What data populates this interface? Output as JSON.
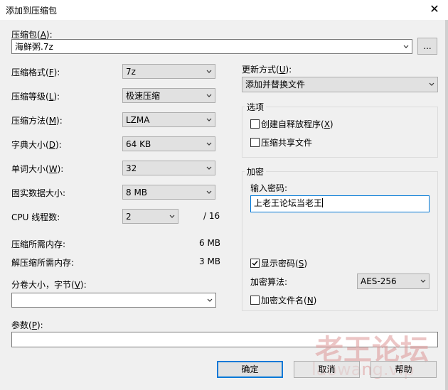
{
  "window": {
    "title": "添加到压缩包",
    "close_glyph": "✕"
  },
  "archive": {
    "label_pre": "压缩包(",
    "label_key": "A",
    "label_post": "):",
    "value": "海鲜粥.7z",
    "browse_label": "..."
  },
  "format": {
    "label_pre": "压缩格式(",
    "label_key": "F",
    "label_post": "):",
    "value": "7z"
  },
  "level": {
    "label_pre": "压缩等级(",
    "label_key": "L",
    "label_post": "):",
    "value": "极速压缩"
  },
  "method": {
    "label_pre": "压缩方法(",
    "label_key": "M",
    "label_post": "):",
    "value": "LZMA"
  },
  "dict": {
    "label_pre": "字典大小(",
    "label_key": "D",
    "label_post": "):",
    "value": "64 KB"
  },
  "word": {
    "label_pre": "单词大小(",
    "label_key": "W",
    "label_post": "):",
    "value": "32"
  },
  "solid": {
    "label": "固实数据大小:",
    "value": "8 MB"
  },
  "threads": {
    "label": "CPU 线程数:",
    "value": "2",
    "total": "/ 16"
  },
  "mem_compress": {
    "label": "压缩所需内存:",
    "value": "6 MB"
  },
  "mem_decompress": {
    "label": "解压缩所需内存:",
    "value": "3 MB"
  },
  "volume": {
    "label_pre": "分卷大小，字节(",
    "label_key": "V",
    "label_post": "):",
    "value": ""
  },
  "params": {
    "label_pre": "参数(",
    "label_key": "P",
    "label_post": "):",
    "value": ""
  },
  "update": {
    "label_pre": "更新方式(",
    "label_key": "U",
    "label_post": "):",
    "value": "添加并替换文件"
  },
  "options": {
    "title": "选项",
    "sfx": {
      "label_pre": "创建自释放程序(",
      "label_key": "X",
      "label_post": ")",
      "checked": false
    },
    "shared": {
      "label": "压缩共享文件",
      "checked": false
    }
  },
  "encryption": {
    "title": "加密",
    "password_label": "输入密码:",
    "password_value": "上老王论坛当老王",
    "show_password": {
      "label_pre": "显示密码(",
      "label_key": "S",
      "label_post": ")",
      "checked": true
    },
    "algorithm_label": "加密算法:",
    "algorithm_value": "AES-256",
    "encrypt_names": {
      "label_pre": "加密文件名(",
      "label_key": "N",
      "label_post": ")",
      "checked": false
    }
  },
  "buttons": {
    "ok": "确定",
    "cancel": "取消",
    "help": "帮助"
  },
  "watermark": {
    "text_cn": "老王论坛",
    "text_url": "laowang.vip",
    "color": "#e8a0a0"
  }
}
